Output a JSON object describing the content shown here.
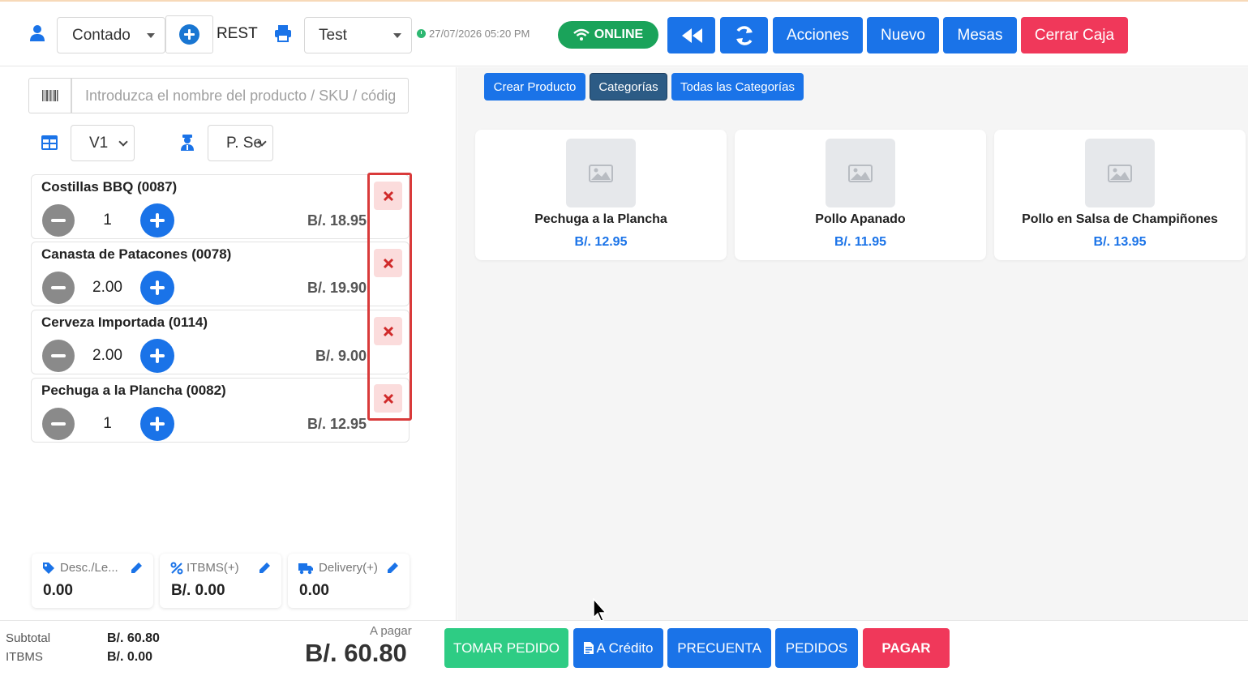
{
  "header": {
    "client_select": "Contado",
    "mode_label": "REST",
    "terminal_select": "Test",
    "datetime": "27/07/2026 05:20 PM",
    "online_label": "ONLINE",
    "acciones_label": "Acciones",
    "nuevo_label": "Nuevo",
    "mesas_label": "Mesas",
    "cerrar_caja_label": "Cerrar Caja"
  },
  "left": {
    "search_placeholder": "Introduzca el nombre del producto / SKU / código",
    "table_select": "V1",
    "waiter_select": "P. Se",
    "items": [
      {
        "name": "Costillas BBQ (0087)",
        "qty": "1",
        "price": "B/. 18.95"
      },
      {
        "name": "Canasta de Patacones (0078)",
        "qty": "2.00",
        "price": "B/. 19.90"
      },
      {
        "name": "Cerveza Importada (0114)",
        "qty": "2.00",
        "price": "B/. 9.00"
      },
      {
        "name": "Pechuga a la Plancha (0082)",
        "qty": "1",
        "price": "B/. 12.95"
      }
    ],
    "summary": {
      "discount": {
        "label": "Desc./Le...",
        "value": "0.00"
      },
      "itbms": {
        "label": "ITBMS(+)",
        "value": "B/. 0.00"
      },
      "delivery": {
        "label": "Delivery(+)",
        "value": "0.00"
      }
    }
  },
  "right": {
    "tabs": [
      "Crear Producto",
      "Categorías",
      "Todas las Categorías"
    ],
    "products": [
      {
        "name": "Pechuga a la Plancha",
        "price": "B/. 12.95"
      },
      {
        "name": "Pollo Apanado",
        "price": "B/. 11.95"
      },
      {
        "name": "Pollo en Salsa de Champiñones",
        "price": "B/. 13.95"
      }
    ]
  },
  "footer": {
    "subtotal_label": "Subtotal",
    "subtotal_value": "B/. 60.80",
    "itbms_label": "ITBMS",
    "itbms_value": "B/. 0.00",
    "apagar_label": "A pagar",
    "total_value": "B/. 60.80",
    "tomar_pedido": "TOMAR PEDIDO",
    "a_credito": "A Crédito",
    "precuenta": "PRECUENTA",
    "pedidos": "PEDIDOS",
    "pagar": "PAGAR"
  },
  "colors": {
    "primary": "#1a73e8",
    "danger": "#f0385a",
    "success": "#1aa35a",
    "tomar": "#2ecc84"
  }
}
